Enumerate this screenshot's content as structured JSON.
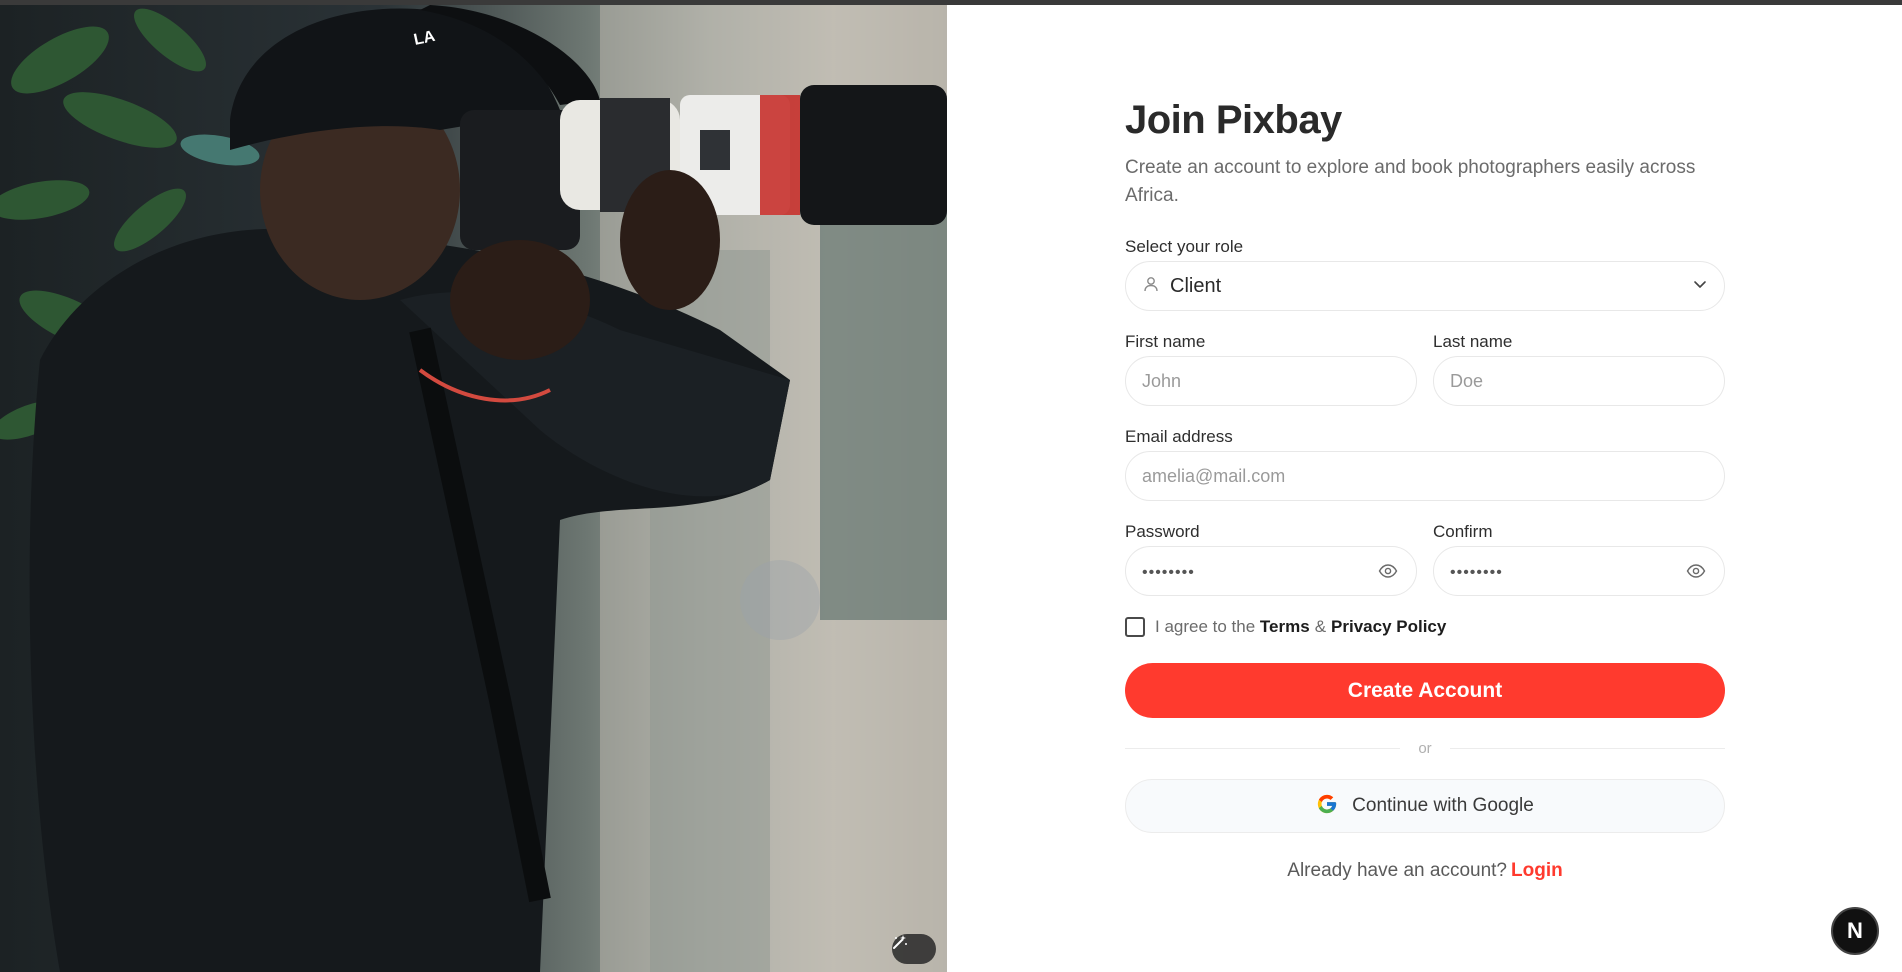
{
  "app": {
    "name": "Pixbay"
  },
  "form": {
    "title": "Join Pixbay",
    "subtitle": "Create an account to explore and book photographers easily across Africa.",
    "role": {
      "label": "Select your role",
      "value": "Client"
    },
    "first_name": {
      "label": "First name",
      "placeholder": "John"
    },
    "last_name": {
      "label": "Last name",
      "placeholder": "Doe"
    },
    "email": {
      "label": "Email address",
      "placeholder": "amelia@mail.com"
    },
    "password": {
      "label": "Password",
      "placeholder": "••••••••"
    },
    "confirm": {
      "label": "Confirm",
      "placeholder": "••••••••"
    },
    "agree": {
      "prefix": "I agree to the",
      "terms": "Terms",
      "amp": "&",
      "privacy": "Privacy Policy"
    },
    "create_button": "Create Account",
    "divider": "or",
    "google_button": "Continue with Google",
    "login_prompt": "Already have an account?",
    "login_link": "Login"
  },
  "badge": {
    "letter": "N"
  },
  "colors": {
    "accent": "#ff3a2e",
    "text": "#2a2a2a",
    "muted": "#6b6b6b",
    "border": "#e8e8e8"
  },
  "icons": [
    "user-icon",
    "chevron-down-icon",
    "eye-icon",
    "google-icon",
    "magic-wand-icon"
  ]
}
